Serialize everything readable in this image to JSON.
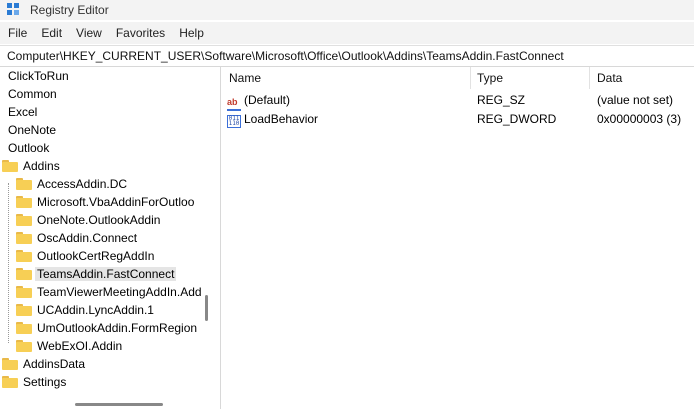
{
  "window": {
    "title": "Registry Editor"
  },
  "menu": [
    "File",
    "Edit",
    "View",
    "Favorites",
    "Help"
  ],
  "address": "Computer\\HKEY_CURRENT_USER\\Software\\Microsoft\\Office\\Outlook\\Addins\\TeamsAddin.FastConnect",
  "tree": {
    "items": [
      {
        "label": "ClickToRun",
        "folder": false,
        "depth": 0,
        "selected": false
      },
      {
        "label": "Common",
        "folder": false,
        "depth": 0,
        "selected": false
      },
      {
        "label": "Excel",
        "folder": false,
        "depth": 0,
        "selected": false
      },
      {
        "label": "OneNote",
        "folder": false,
        "depth": 0,
        "selected": false
      },
      {
        "label": "Outlook",
        "folder": false,
        "depth": 0,
        "selected": false
      },
      {
        "label": "Addins",
        "folder": true,
        "depth": 0,
        "selected": false
      },
      {
        "label": "AccessAddin.DC",
        "folder": true,
        "depth": 1,
        "selected": false
      },
      {
        "label": "Microsoft.VbaAddinForOutloo",
        "folder": true,
        "depth": 1,
        "selected": false
      },
      {
        "label": "OneNote.OutlookAddin",
        "folder": true,
        "depth": 1,
        "selected": false
      },
      {
        "label": "OscAddin.Connect",
        "folder": true,
        "depth": 1,
        "selected": false
      },
      {
        "label": "OutlookCertRegAddIn",
        "folder": true,
        "depth": 1,
        "selected": false
      },
      {
        "label": "TeamsAddin.FastConnect",
        "folder": true,
        "depth": 1,
        "selected": true
      },
      {
        "label": "TeamViewerMeetingAddIn.Add",
        "folder": true,
        "depth": 1,
        "selected": false
      },
      {
        "label": "UCAddin.LyncAddin.1",
        "folder": true,
        "depth": 1,
        "selected": false
      },
      {
        "label": "UmOutlookAddin.FormRegion",
        "folder": true,
        "depth": 1,
        "selected": false
      },
      {
        "label": "WebExOI.Addin",
        "folder": true,
        "depth": 1,
        "selected": false
      },
      {
        "label": "AddinsData",
        "folder": true,
        "depth": 0,
        "selected": false
      },
      {
        "label": "Settings",
        "folder": true,
        "depth": 0,
        "selected": false
      }
    ]
  },
  "list": {
    "columns": {
      "name": "Name",
      "type": "Type",
      "data": "Data"
    },
    "rows": [
      {
        "icon": "string-value-icon",
        "name": "(Default)",
        "type": "REG_SZ",
        "data": "(value not set)"
      },
      {
        "icon": "binary-value-icon",
        "name": "LoadBehavior",
        "type": "REG_DWORD",
        "data": "0x00000003 (3)"
      }
    ]
  },
  "colors": {
    "folder": "#f7cf55",
    "selection": "#e5e5e5",
    "app_icon": "#2a7bd4"
  }
}
